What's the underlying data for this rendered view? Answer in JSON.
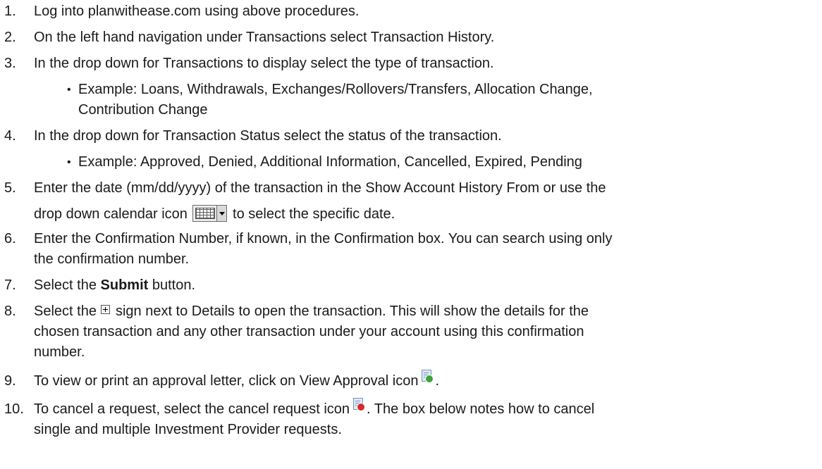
{
  "steps": [
    {
      "num": "1.",
      "text": "Log into planwithease.com using above procedures."
    },
    {
      "num": "2.",
      "text": "On the left hand navigation under Transactions select Transaction History."
    },
    {
      "num": "3.",
      "text": "In the drop down for Transactions to display select the type of transaction."
    },
    {
      "num": "4.",
      "text": "In the drop down for Transaction Status select the status of the transaction."
    },
    {
      "num": "5.",
      "text_before": "Enter the date (mm/dd/yyyy) of the transaction in the Show Account History From or use the",
      "text_line2": "drop down calendar icon",
      "text_after": "to select the specific date."
    },
    {
      "num": "6.",
      "line1": "Enter the Confirmation Number, if known, in the Confirmation box. You can search using only",
      "line2": "the confirmation number."
    },
    {
      "num": "7.",
      "text_before": "Select the",
      "bold": "Submit",
      "text_after": "button."
    },
    {
      "num": "8.",
      "text_before": "Select the",
      "text_after": "sign next to Details to open the transaction. This will show the details for the",
      "line2": "chosen transaction and any other transaction under your account using this confirmation",
      "line3": "number."
    },
    {
      "num": "9.",
      "text_before": "To view or print an approval letter, click on View Approval icon",
      "text_after": "."
    },
    {
      "num": "10.",
      "text_before": "To cancel a request, select the cancel request icon",
      "text_after": ". The box below notes how to cancel",
      "line2": "single and multiple Investment Provider requests."
    }
  ],
  "sub_bullets": {
    "step3": {
      "line1": "Example: Loans, Withdrawals, Exchanges/Rollovers/Transfers, Allocation Change,",
      "line2": "Contribution Change"
    },
    "step4": {
      "line1": "Example: Approved, Denied, Additional Information, Cancelled, Expired, Pending"
    }
  },
  "bullet_char": "•",
  "icons": {
    "calendar": "calendar-dropdown-icon",
    "plus": "expand-plus-icon",
    "approve": "view-approval-icon",
    "cancel": "cancel-request-icon"
  },
  "colors": {
    "text": "#1a1a1a",
    "approve_green": "#3aa53a",
    "cancel_red": "#d52a2a"
  }
}
